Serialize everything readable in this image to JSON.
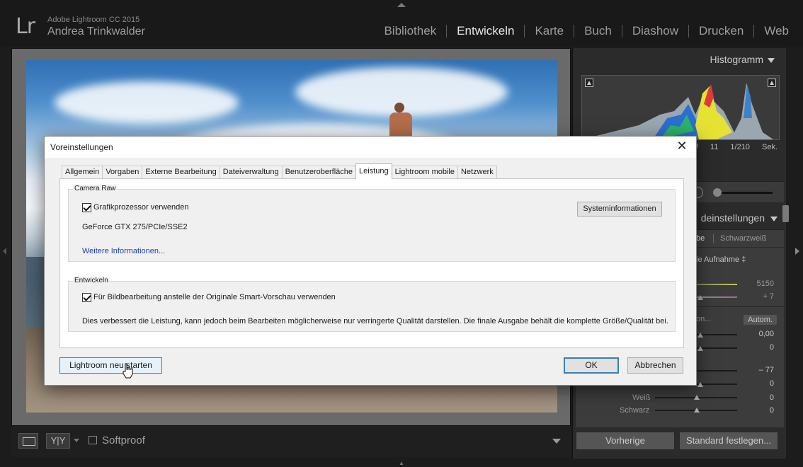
{
  "app": {
    "logo": "Lr",
    "version": "Adobe Lightroom CC 2015",
    "user": "Andrea Trinkwalder"
  },
  "modules": [
    "Bibliothek",
    "Entwickeln",
    "Karte",
    "Buch",
    "Diashow",
    "Drucken",
    "Web"
  ],
  "active_module": "Entwickeln",
  "right_panel": {
    "histogram_title": "Histogramm",
    "histogram_info": "/ 11   1/210 Sek.",
    "basic_title": "deinstellungen",
    "treatment_partial": "be",
    "treatment_bw": "Schwarzweiß",
    "wb_partial": "ie Aufnahme ‡",
    "temp_value": "5150",
    "tint_value": "+ 7",
    "tone_partial": "on...",
    "auto_label": "Autom.",
    "exposure_value": "0,00",
    "contrast_value": "0",
    "highlights_value": "– 77",
    "shadows_value": "0",
    "whites_label": "Weiß",
    "whites_value": "0",
    "blacks_label": "Schwarz",
    "blacks_value": "0",
    "extra_value": "0",
    "prev_button": "Vorherige",
    "std_button": "Standard festlegen..."
  },
  "toolbar": {
    "view_yy": "Y|Y",
    "softproof_label": "Softproof"
  },
  "dialog": {
    "title": "Voreinstellungen",
    "tabs": [
      "Allgemein",
      "Vorgaben",
      "Externe Bearbeitung",
      "Dateiverwaltung",
      "Benutzeroberfläche",
      "Leistung",
      "Lightroom mobile",
      "Netzwerk"
    ],
    "active_tab": "Leistung",
    "camera_raw": {
      "legend": "Camera Raw",
      "gpu_checkbox_label": "Grafikprozessor verwenden",
      "gpu_checked": true,
      "gpu_name": "GeForce GTX 275/PCIe/SSE2",
      "more_info_link": "Weitere Informationen...",
      "sysinfo_button": "Systeminformationen"
    },
    "develop": {
      "legend": "Entwickeln",
      "smart_preview_label": "Für Bildbearbeitung anstelle der Originale Smart-Vorschau verwenden",
      "smart_preview_checked": true,
      "description": "Dies verbessert die Leistung, kann jedoch beim Bearbeiten möglicherweise nur verringerte Qualität darstellen. Die finale Ausgabe behält die komplette Größe/Qualität bei."
    },
    "buttons": {
      "restart": "Lightroom neu starten",
      "ok": "OK",
      "cancel": "Abbrechen"
    }
  }
}
